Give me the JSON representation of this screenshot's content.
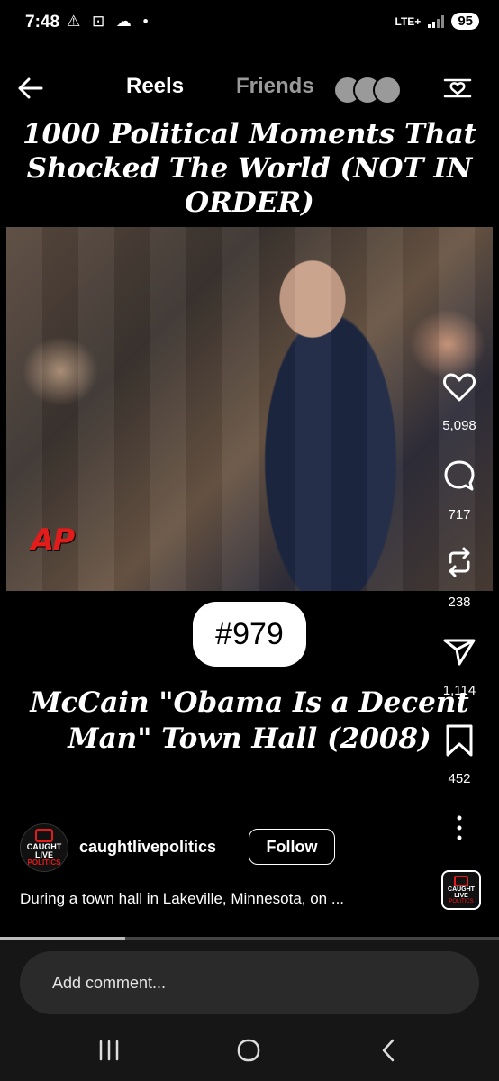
{
  "status_bar": {
    "time": "7:48",
    "left_icons": "⚠ ⊡ ☁ •",
    "network": "LTE+",
    "battery": "95"
  },
  "header": {
    "tabs": [
      {
        "label": "Reels",
        "active": true
      },
      {
        "label": "Friends",
        "active": false
      }
    ]
  },
  "reel": {
    "overlay_title": "1000 Political Moments That Shocked The World (NOT IN ORDER)",
    "video_watermark": "AP",
    "badge": "#979",
    "caption_title": "McCain \"Obama Is a Decent Man\" Town Hall (2008)",
    "progress": 0.25
  },
  "actions": {
    "likes": "5,098",
    "comments": "717",
    "reposts": "238",
    "shares": "1,114",
    "saves": "452"
  },
  "account": {
    "avatar_line1": "CAUGHT",
    "avatar_line2": "LIVE",
    "avatar_line3": "POLITICS",
    "username": "caughtlivepolitics",
    "follow_label": "Follow",
    "description": "During a town hall in Lakeville, Minnesota, on ..."
  },
  "comment": {
    "placeholder": "Add comment..."
  },
  "colors": {
    "background": "#000000",
    "brand_red": "#e21b1b",
    "inactive_tab": "#9a9a9a"
  }
}
